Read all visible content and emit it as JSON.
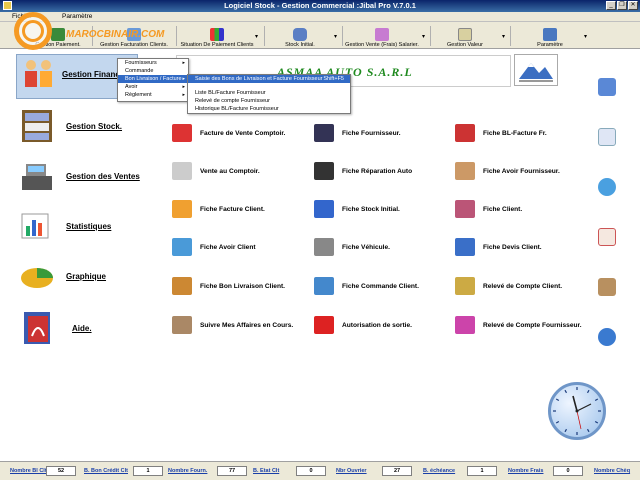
{
  "window": {
    "title": "Logiciel  Stock - Gestion Commercial :Jibal Pro V.7.0.1",
    "controls": [
      "_",
      "❐",
      "✕"
    ]
  },
  "menubar": {
    "items": [
      "Fichier",
      "Paramètre"
    ]
  },
  "toolbar": {
    "items": [
      {
        "label": "Gestion Paiement."
      },
      {
        "label": "Gestion Facturation Clients."
      },
      {
        "label": "Situation De Paiement Clients"
      },
      {
        "label": "Stock Initial."
      },
      {
        "label": "Gestion Vente (Frais) Salarier."
      },
      {
        "label": "Gestion Valeur"
      },
      {
        "label": "Paramètre"
      }
    ]
  },
  "watermark": {
    "text": "MAROCBINAIR.COM"
  },
  "banner": {
    "text": "ASMAA AUTO S.A.R.L"
  },
  "left_menu": {
    "finance": "Gestion Financière",
    "stock": "Gestion Stock.",
    "ventes": "Gestion des Ventes",
    "stats": "Statistiques",
    "graph": "Graphique",
    "aide": "Aide."
  },
  "dropdown1": {
    "items": [
      "Fournisseurs",
      "Commande",
      "Bon Livraison / Facture",
      "Avoir",
      "Règlement"
    ]
  },
  "dropdown2": {
    "items": [
      "Saisie des Bons de Livraison et Facture Fournisseur",
      "Liste BL/Facture Fournisseur",
      "Relevé de compte Fournisseur",
      "Historique BL/Facture Fournisseur"
    ],
    "shortcut": "Shift+F5"
  },
  "grid": {
    "col1": [
      "Facture de Vente Comptoir.",
      "Vente au Comptoir.",
      "Fiche Facture Client.",
      "Fiche Avoir Client",
      "Fiche Bon Livraison Client.",
      "Suivre Mes Affaires en Cours."
    ],
    "col2": [
      "Fiche Fournisseur.",
      "Fiche Réparation Auto",
      "Fiche Stock Initial.",
      "Fiche Véhicule.",
      "Fiche Commande Client.",
      "Autorisation de sortie."
    ],
    "col3": [
      "Fiche BL-Facture Fr.",
      "Fiche Avoir Fournisseur.",
      "Fiche Client.",
      "Fiche Devis Client.",
      "Relevé de Compte Client.",
      "Relevé de Compte Fournisseur."
    ]
  },
  "status": {
    "labels": [
      "Nombre Bl Clt",
      "B. Bon Crédit Clt",
      "Nombre Fourn.",
      "B. Etat Clt",
      "Nbr Ouvrier",
      "B. échéance",
      "Nombre Frais",
      "Nombre Chèq"
    ],
    "values": [
      "52",
      "1",
      "77",
      "0",
      "27",
      "1",
      "0"
    ]
  },
  "colors": {
    "accent": "#316ac5",
    "title_bar": "#0a246a",
    "watermark": "#f59a23"
  }
}
